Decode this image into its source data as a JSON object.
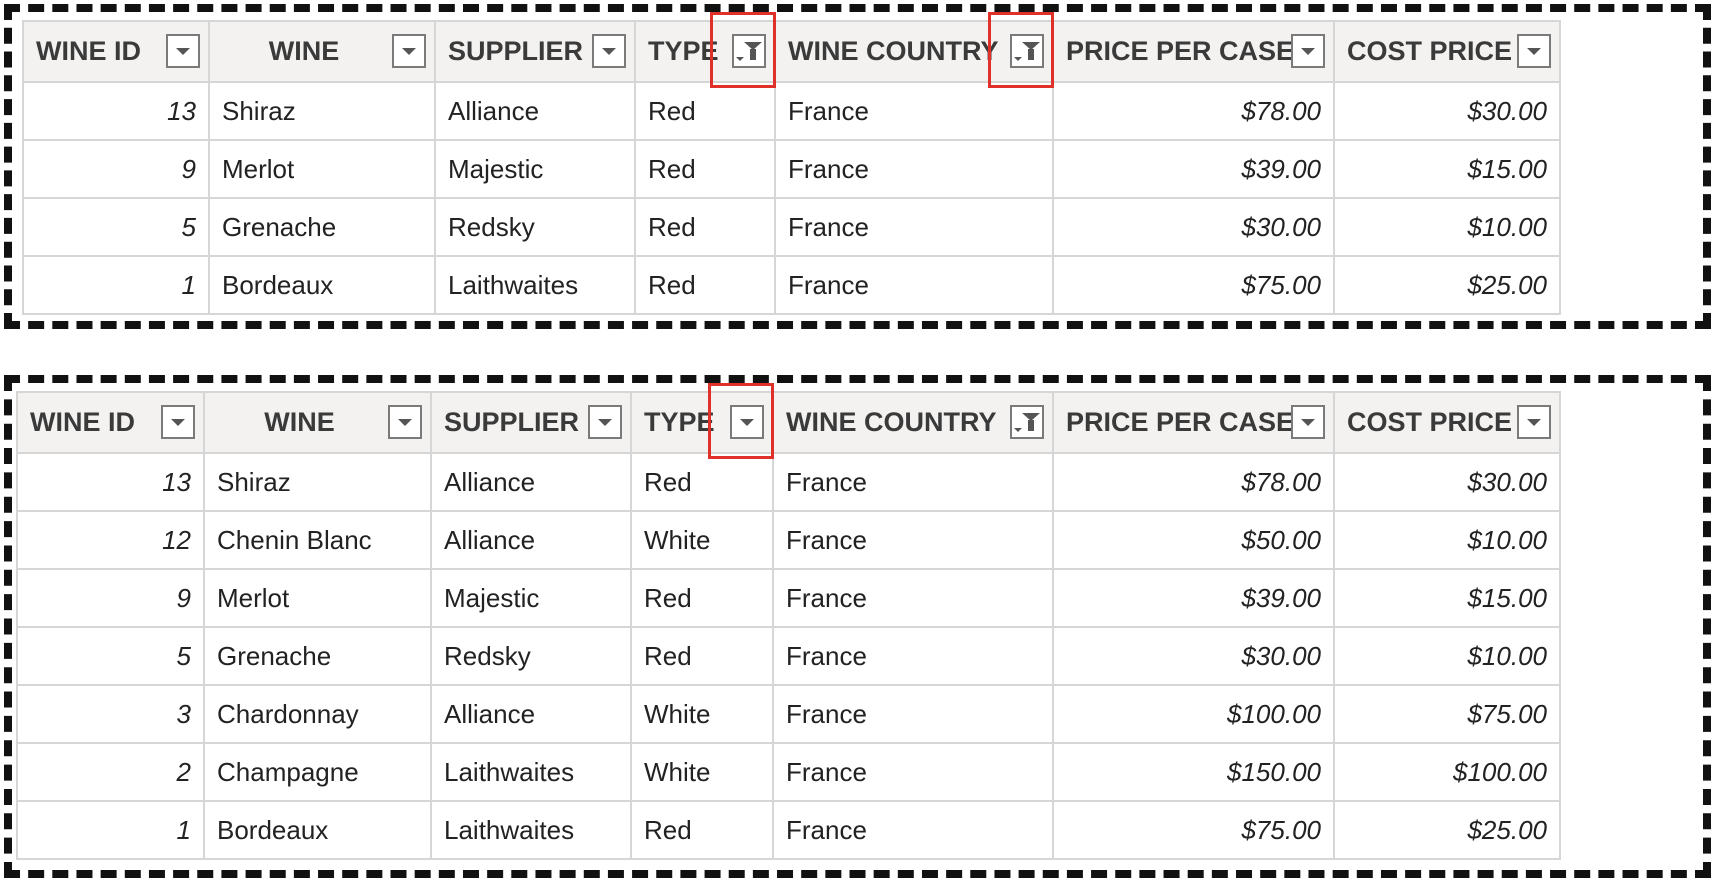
{
  "columns": [
    {
      "id": "wine_id",
      "label": "WINE ID"
    },
    {
      "id": "wine",
      "label": "WINE"
    },
    {
      "id": "supplier",
      "label": "SUPPLIER"
    },
    {
      "id": "type",
      "label": "TYPE"
    },
    {
      "id": "wine_country",
      "label": "WINE COUNTRY"
    },
    {
      "id": "price_per_case",
      "label": "PRICE PER CASE"
    },
    {
      "id": "cost_price",
      "label": "COST PRICE"
    }
  ],
  "top_table": {
    "filtered_columns": [
      "type",
      "wine_country"
    ],
    "highlighted_columns": [
      "type",
      "wine_country"
    ],
    "rows": [
      [
        "13",
        "Shiraz",
        "Alliance",
        "Red",
        "France",
        "$78.00",
        "$30.00"
      ],
      [
        "9",
        "Merlot",
        "Majestic",
        "Red",
        "France",
        "$39.00",
        "$15.00"
      ],
      [
        "5",
        "Grenache",
        "Redsky",
        "Red",
        "France",
        "$30.00",
        "$10.00"
      ],
      [
        "1",
        "Bordeaux",
        "Laithwaites",
        "Red",
        "France",
        "$75.00",
        "$25.00"
      ]
    ]
  },
  "bottom_table": {
    "filtered_columns": [
      "wine_country"
    ],
    "highlighted_columns": [
      "type"
    ],
    "rows": [
      [
        "13",
        "Shiraz",
        "Alliance",
        "Red",
        "France",
        "$78.00",
        "$30.00"
      ],
      [
        "12",
        "Chenin Blanc",
        "Alliance",
        "White",
        "France",
        "$50.00",
        "$10.00"
      ],
      [
        "9",
        "Merlot",
        "Majestic",
        "Red",
        "France",
        "$39.00",
        "$15.00"
      ],
      [
        "5",
        "Grenache",
        "Redsky",
        "Red",
        "France",
        "$30.00",
        "$10.00"
      ],
      [
        "3",
        "Chardonnay",
        "Alliance",
        "White",
        "France",
        "$100.00",
        "$75.00"
      ],
      [
        "2",
        "Champagne",
        "Laithwaites",
        "White",
        "France",
        "$150.00",
        "$100.00"
      ],
      [
        "1",
        "Bordeaux",
        "Laithwaites",
        "Red",
        "France",
        "$75.00",
        "$25.00"
      ]
    ]
  },
  "colors": {
    "highlight_box": "#e0302a",
    "header_background": "#f3f2f1",
    "panel_border": "#111111",
    "grid_line": "#d6d6d6"
  },
  "icons": {
    "dropdown": "chevron-down-icon",
    "filter_applied": "filter-funnel-icon"
  }
}
